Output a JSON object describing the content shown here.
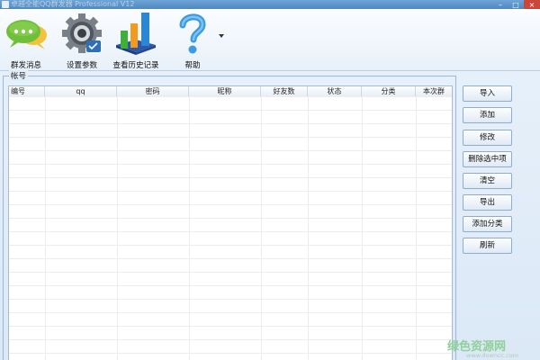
{
  "window": {
    "title": "卓越全能QQ群发器 Professional V12"
  },
  "toolbar": {
    "items": [
      {
        "label": "群发消息",
        "icon": "chat-bubbles-icon"
      },
      {
        "label": "设置参数",
        "icon": "gear-icon"
      },
      {
        "label": "查看历史记录",
        "icon": "bar-chart-book-icon"
      },
      {
        "label": "帮助",
        "icon": "question-mark-icon"
      }
    ]
  },
  "account_group": {
    "legend": "帐号",
    "columns": [
      "编号",
      "qq",
      "密码",
      "昵称",
      "好友数",
      "状态",
      "分类",
      "本次群"
    ]
  },
  "side_buttons": [
    {
      "label": "导入"
    },
    {
      "label": "添加"
    },
    {
      "label": "修改"
    },
    {
      "label": "删除选中项"
    },
    {
      "label": "清空"
    },
    {
      "label": "导出"
    },
    {
      "label": "添加分类"
    },
    {
      "label": "刷新"
    }
  ],
  "watermark": {
    "text": "绿色资源网",
    "url": "www.downcc.com"
  },
  "colors": {
    "accent": "#4e86c0",
    "chat_green": "#6fbf3a",
    "bar_blue": "#2c86d6",
    "bar_green": "#3fae3a",
    "bar_orange": "#f29a1c"
  }
}
